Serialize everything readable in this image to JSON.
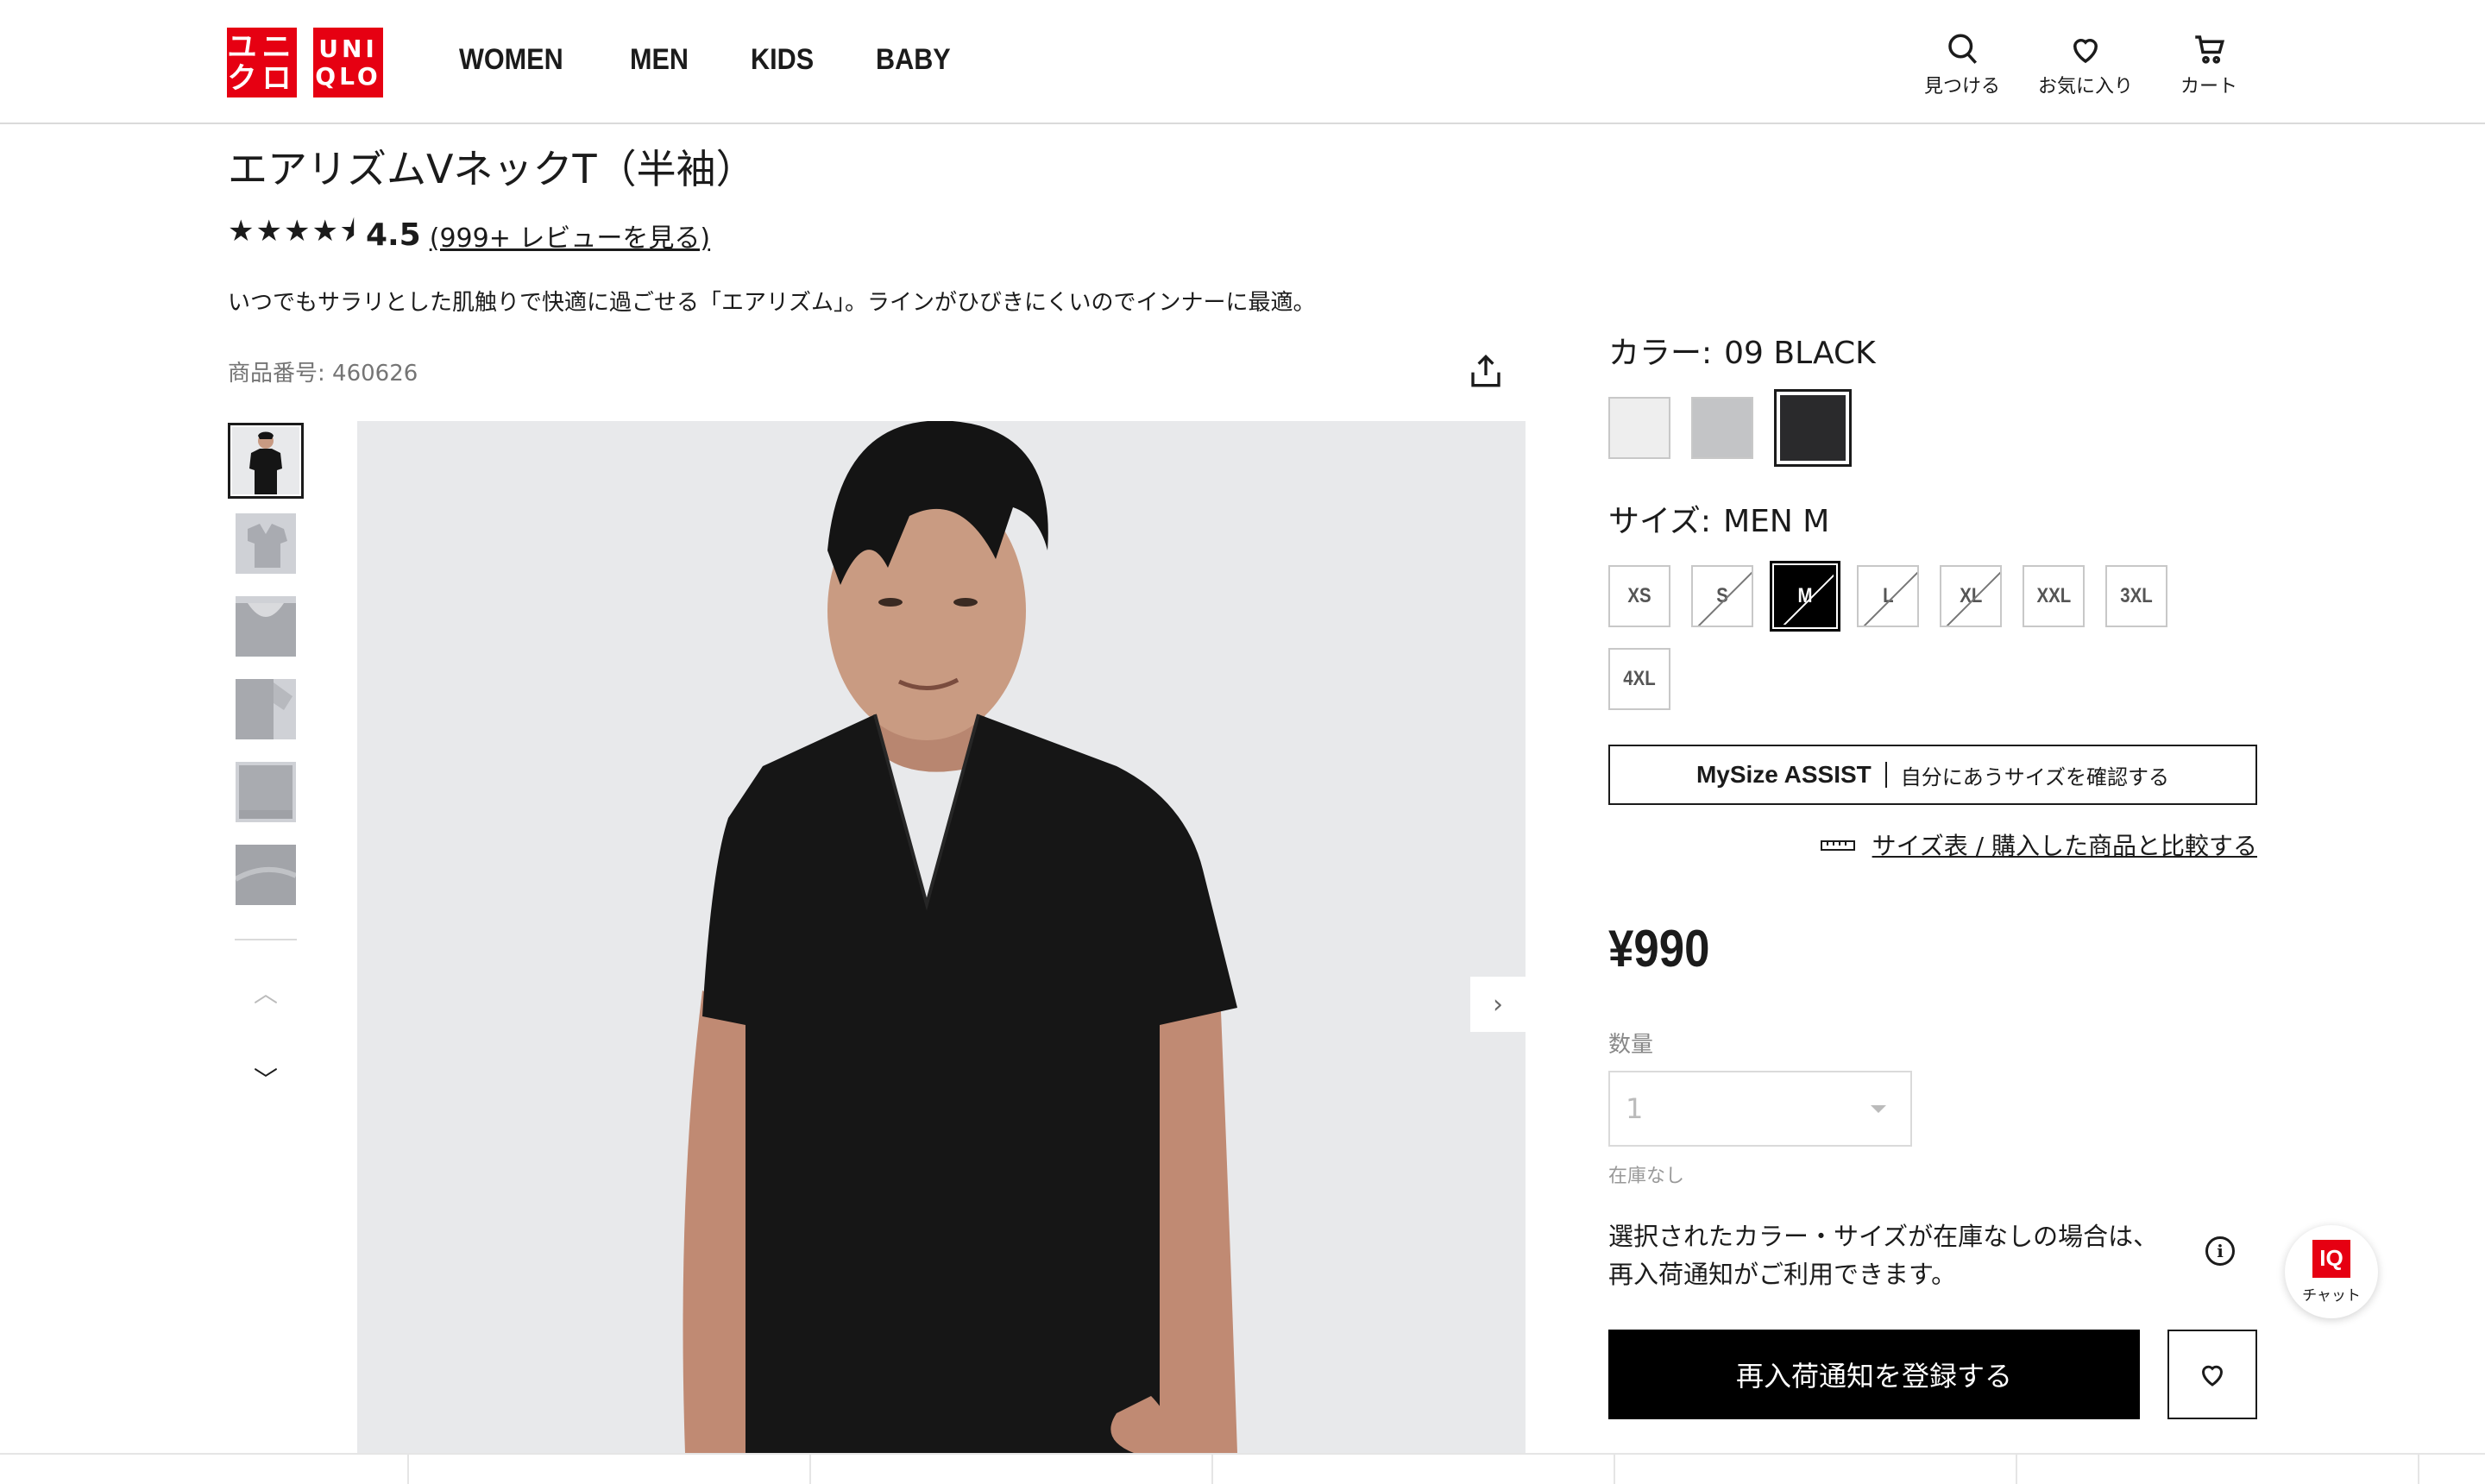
{
  "header": {
    "logo_jp_line1": "ユニ",
    "logo_jp_line2": "クロ",
    "logo_en_line1": "UNI",
    "logo_en_line2": "QLO",
    "nav": [
      "WOMEN",
      "MEN",
      "KIDS",
      "BABY"
    ],
    "icons": [
      {
        "icon": "search-icon",
        "label": "見つける"
      },
      {
        "icon": "heart-icon",
        "label": "お気に入り"
      },
      {
        "icon": "cart-icon",
        "label": "カート"
      }
    ],
    "brand_color": "#e60012"
  },
  "product": {
    "title": "エアリズムVネックT（半袖）",
    "stars": "★★★★⯨",
    "rating": "4.5",
    "reviews_link": "(999+ レビューを見る)",
    "description": "いつでもサラリとした肌触りで快適に過ごせる「エアリズム」。ラインがひびきにくいのでインナーに最適。",
    "product_number": "商品番号: 460626"
  },
  "color": {
    "label": "カラー:",
    "selected": "09 BLACK",
    "swatches": [
      "#eeeeee",
      "#c3c4c6",
      "#2a2a2c"
    ]
  },
  "size": {
    "label": "サイズ:",
    "selected": "MEN M",
    "options": [
      "XS",
      "S",
      "M",
      "L",
      "XL",
      "XXL",
      "3XL",
      "4XL"
    ]
  },
  "mysize": {
    "label": "MySize ASSIST",
    "sub": "自分にあうサイズを確認する"
  },
  "size_chart_link": "サイズ表 / 購入した商品と比較する",
  "price": "¥990",
  "quantity": {
    "label": "数量",
    "value": "1",
    "stock_text": "在庫なし"
  },
  "notice": {
    "line1": "選択されたカラー・サイズが在庫なしの場合は、",
    "line2": "再入荷通知がご利用できます。"
  },
  "cta": "再入荷通知を登録する",
  "chat": {
    "badge": "IQ",
    "label": "チャット"
  }
}
